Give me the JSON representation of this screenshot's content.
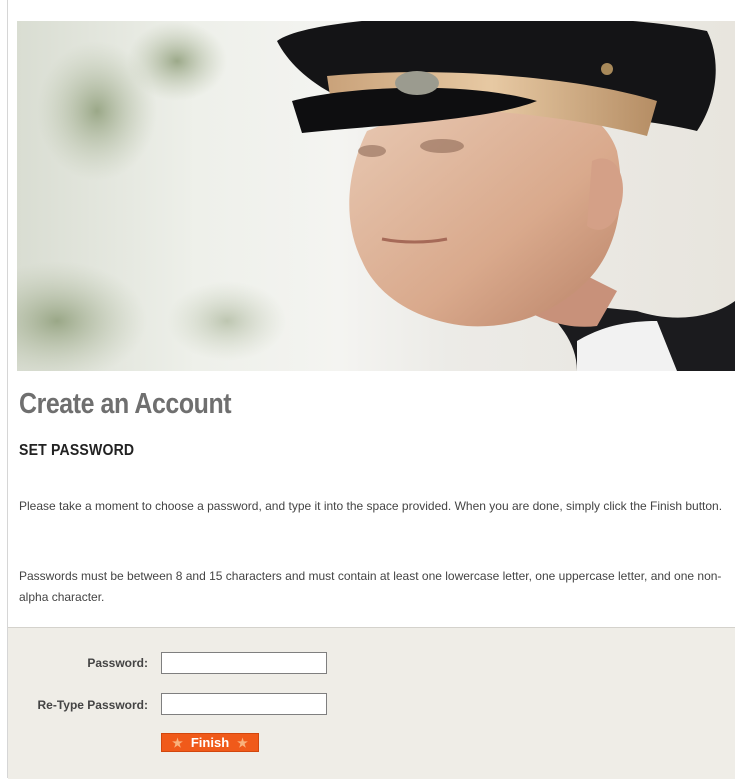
{
  "hero": {
    "image": "soldier-portrait"
  },
  "page": {
    "title": "Create an Account",
    "subtitle": "SET PASSWORD",
    "paragraphs": [
      "Please take a moment to choose a password, and type it into the space provided. When you are done, simply click the Finish button.",
      "Passwords must be between 8 and 15 characters and must contain at least one lowercase letter, one uppercase letter, and one non-alpha character."
    ]
  },
  "form": {
    "password_label": "Password:",
    "password_value": "",
    "retype_label": "Re-Type Password:",
    "retype_value": "",
    "finish_label": "Finish",
    "finish_icon": "star-icon"
  },
  "colors": {
    "accent": "#f05a1a",
    "panel": "#efede7",
    "title": "#6f6f6f"
  }
}
